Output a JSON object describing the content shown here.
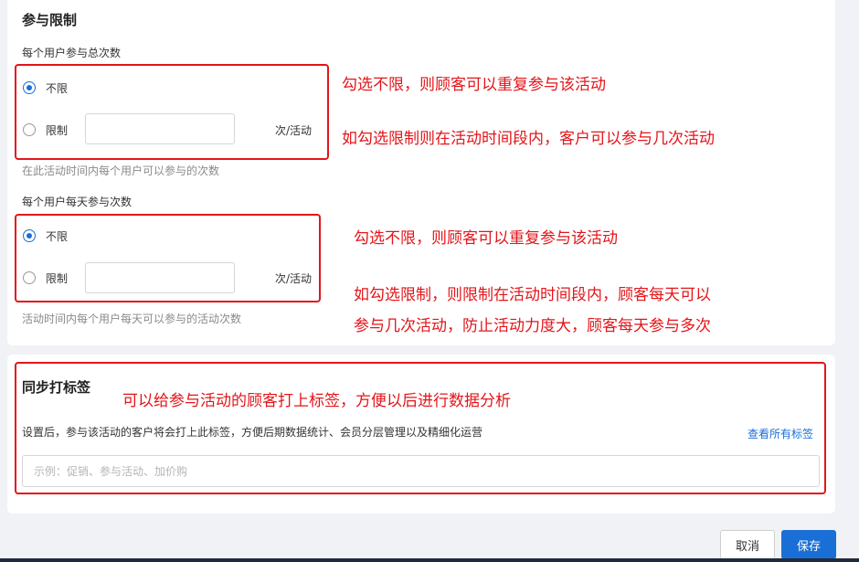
{
  "limits": {
    "title": "参与限制",
    "total": {
      "label": "每个用户参与总次数",
      "opt_unlimited": "不限",
      "opt_limited": "限制",
      "unit": "次/活动",
      "hint": "在此活动时间内每个用户可以参与的次数",
      "selected": "不限"
    },
    "daily": {
      "label": "每个用户每天参与次数",
      "opt_unlimited": "不限",
      "opt_limited": "限制",
      "unit": "次/活动",
      "hint": "活动时间内每个用户每天可以参与的活动次数",
      "selected": "不限"
    }
  },
  "tags": {
    "title": "同步打标签",
    "description": "设置后，参与该活动的客户将会打上此标签，方便后期数据统计、会员分层管理以及精细化运营",
    "view_all_link": "查看所有标签",
    "input_placeholder": "示例：促销、参与活动、加价购",
    "input_value": ""
  },
  "annotations": {
    "a1": "勾选不限，则顾客可以重复参与该活动",
    "a2": "如勾选限制则在活动时间段内，客户可以参与几次活动",
    "a3": "勾选不限，则顾客可以重复参与该活动",
    "a4_line1": "如勾选限制，则限制在活动时间段内，顾客每天可以",
    "a4_line2": "参与几次活动，防止活动力度大，顾客每天参与多次",
    "a5": "可以给参与活动的顾客打上标签，方便以后进行数据分析",
    "color": "#e3151a"
  },
  "footer": {
    "cancel_label": "取消",
    "save_label": "保存"
  },
  "colors": {
    "accent": "#1a6fd6",
    "page_bg": "#f0f2f5",
    "annotation_red": "#e3151a"
  }
}
